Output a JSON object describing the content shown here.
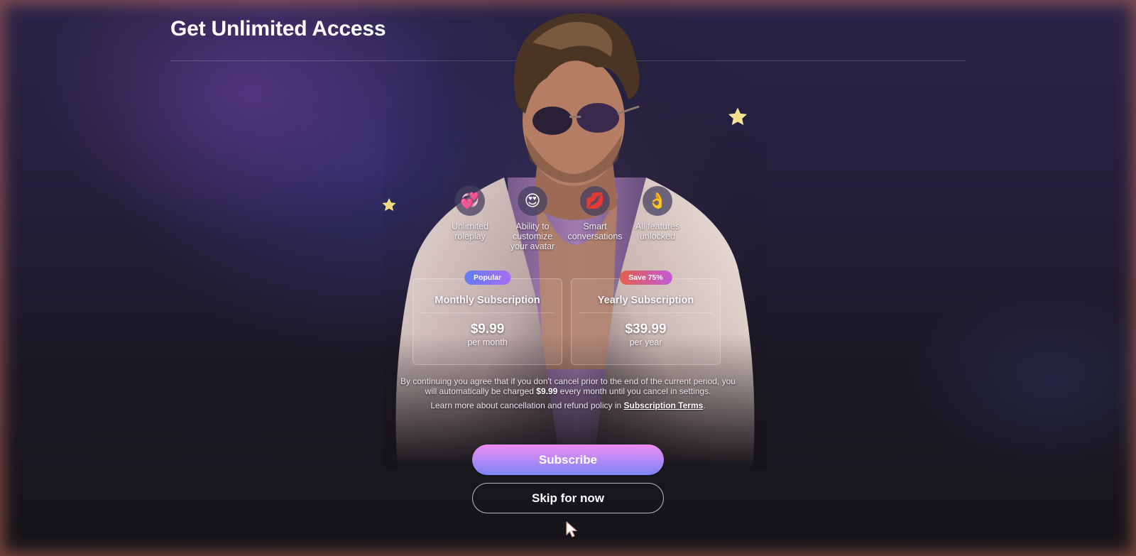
{
  "page": {
    "title": "Get Unlimited Access"
  },
  "features": [
    {
      "icon": "heart-icon",
      "emoji": "💞",
      "label": "Unlimited roleplay"
    },
    {
      "icon": "heart-eyes-icon",
      "emoji": "😍",
      "label": "Ability to customize your avatar"
    },
    {
      "icon": "lips-icon",
      "emoji": "💋",
      "label": "Smart conversations"
    },
    {
      "icon": "ok-hand-icon",
      "emoji": "👌",
      "label": "All features unlocked"
    }
  ],
  "plans": [
    {
      "badge": "Popular",
      "name": "Monthly Subscription",
      "price": "$9.99",
      "period": "per month"
    },
    {
      "badge": "Save 75%",
      "name": "Yearly Subscription",
      "price": "$39.99",
      "period": "per year"
    }
  ],
  "legal": {
    "line1_before": "By continuing you agree that if you don't cancel prior to the end of the current period, you will automatically be charged ",
    "charge": "$9.99",
    "line1_after": " every month until you cancel in settings.",
    "line2_before": "Learn more about cancellation and refund policy in ",
    "terms_link": "Subscription Terms",
    "line2_after": "."
  },
  "buttons": {
    "subscribe": "Subscribe",
    "skip": "Skip for now"
  },
  "colors": {
    "accent_gradient_start": "#ee8cf0",
    "accent_gradient_end": "#7a86f5",
    "popular_badge": "#5f7df5",
    "save_badge": "#e2604a"
  }
}
